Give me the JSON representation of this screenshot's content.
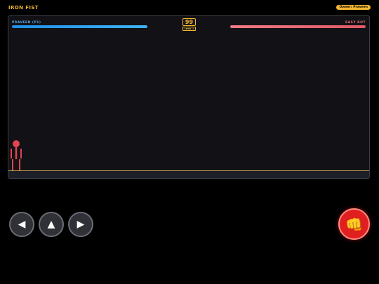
{
  "game": {
    "title": "IRON FIST",
    "owner_badge": "Owner: Praveen"
  },
  "hud": {
    "player1": {
      "name": "PRAVEEN (P1)",
      "health": 1.0,
      "color": "#2aa0f0"
    },
    "player2": {
      "name": "EASY BOT",
      "health": 1.0,
      "color": "#e85d68"
    },
    "timer": "99",
    "level": "LEVEL 1"
  },
  "fighter": {
    "color": "#e0454f",
    "icon": "stick-figure-icon"
  },
  "controls": {
    "left": {
      "label": "◀",
      "icon": "arrow-left-icon"
    },
    "up": {
      "label": "▲",
      "icon": "arrow-up-icon"
    },
    "right": {
      "label": "▶",
      "icon": "arrow-right-icon"
    },
    "punch": {
      "label": "👊",
      "icon": "fist-icon",
      "color": "#e01f1f"
    }
  },
  "colors": {
    "accent": "#f5b731",
    "floor": "#c9a24a",
    "arena_background": "#111116"
  }
}
